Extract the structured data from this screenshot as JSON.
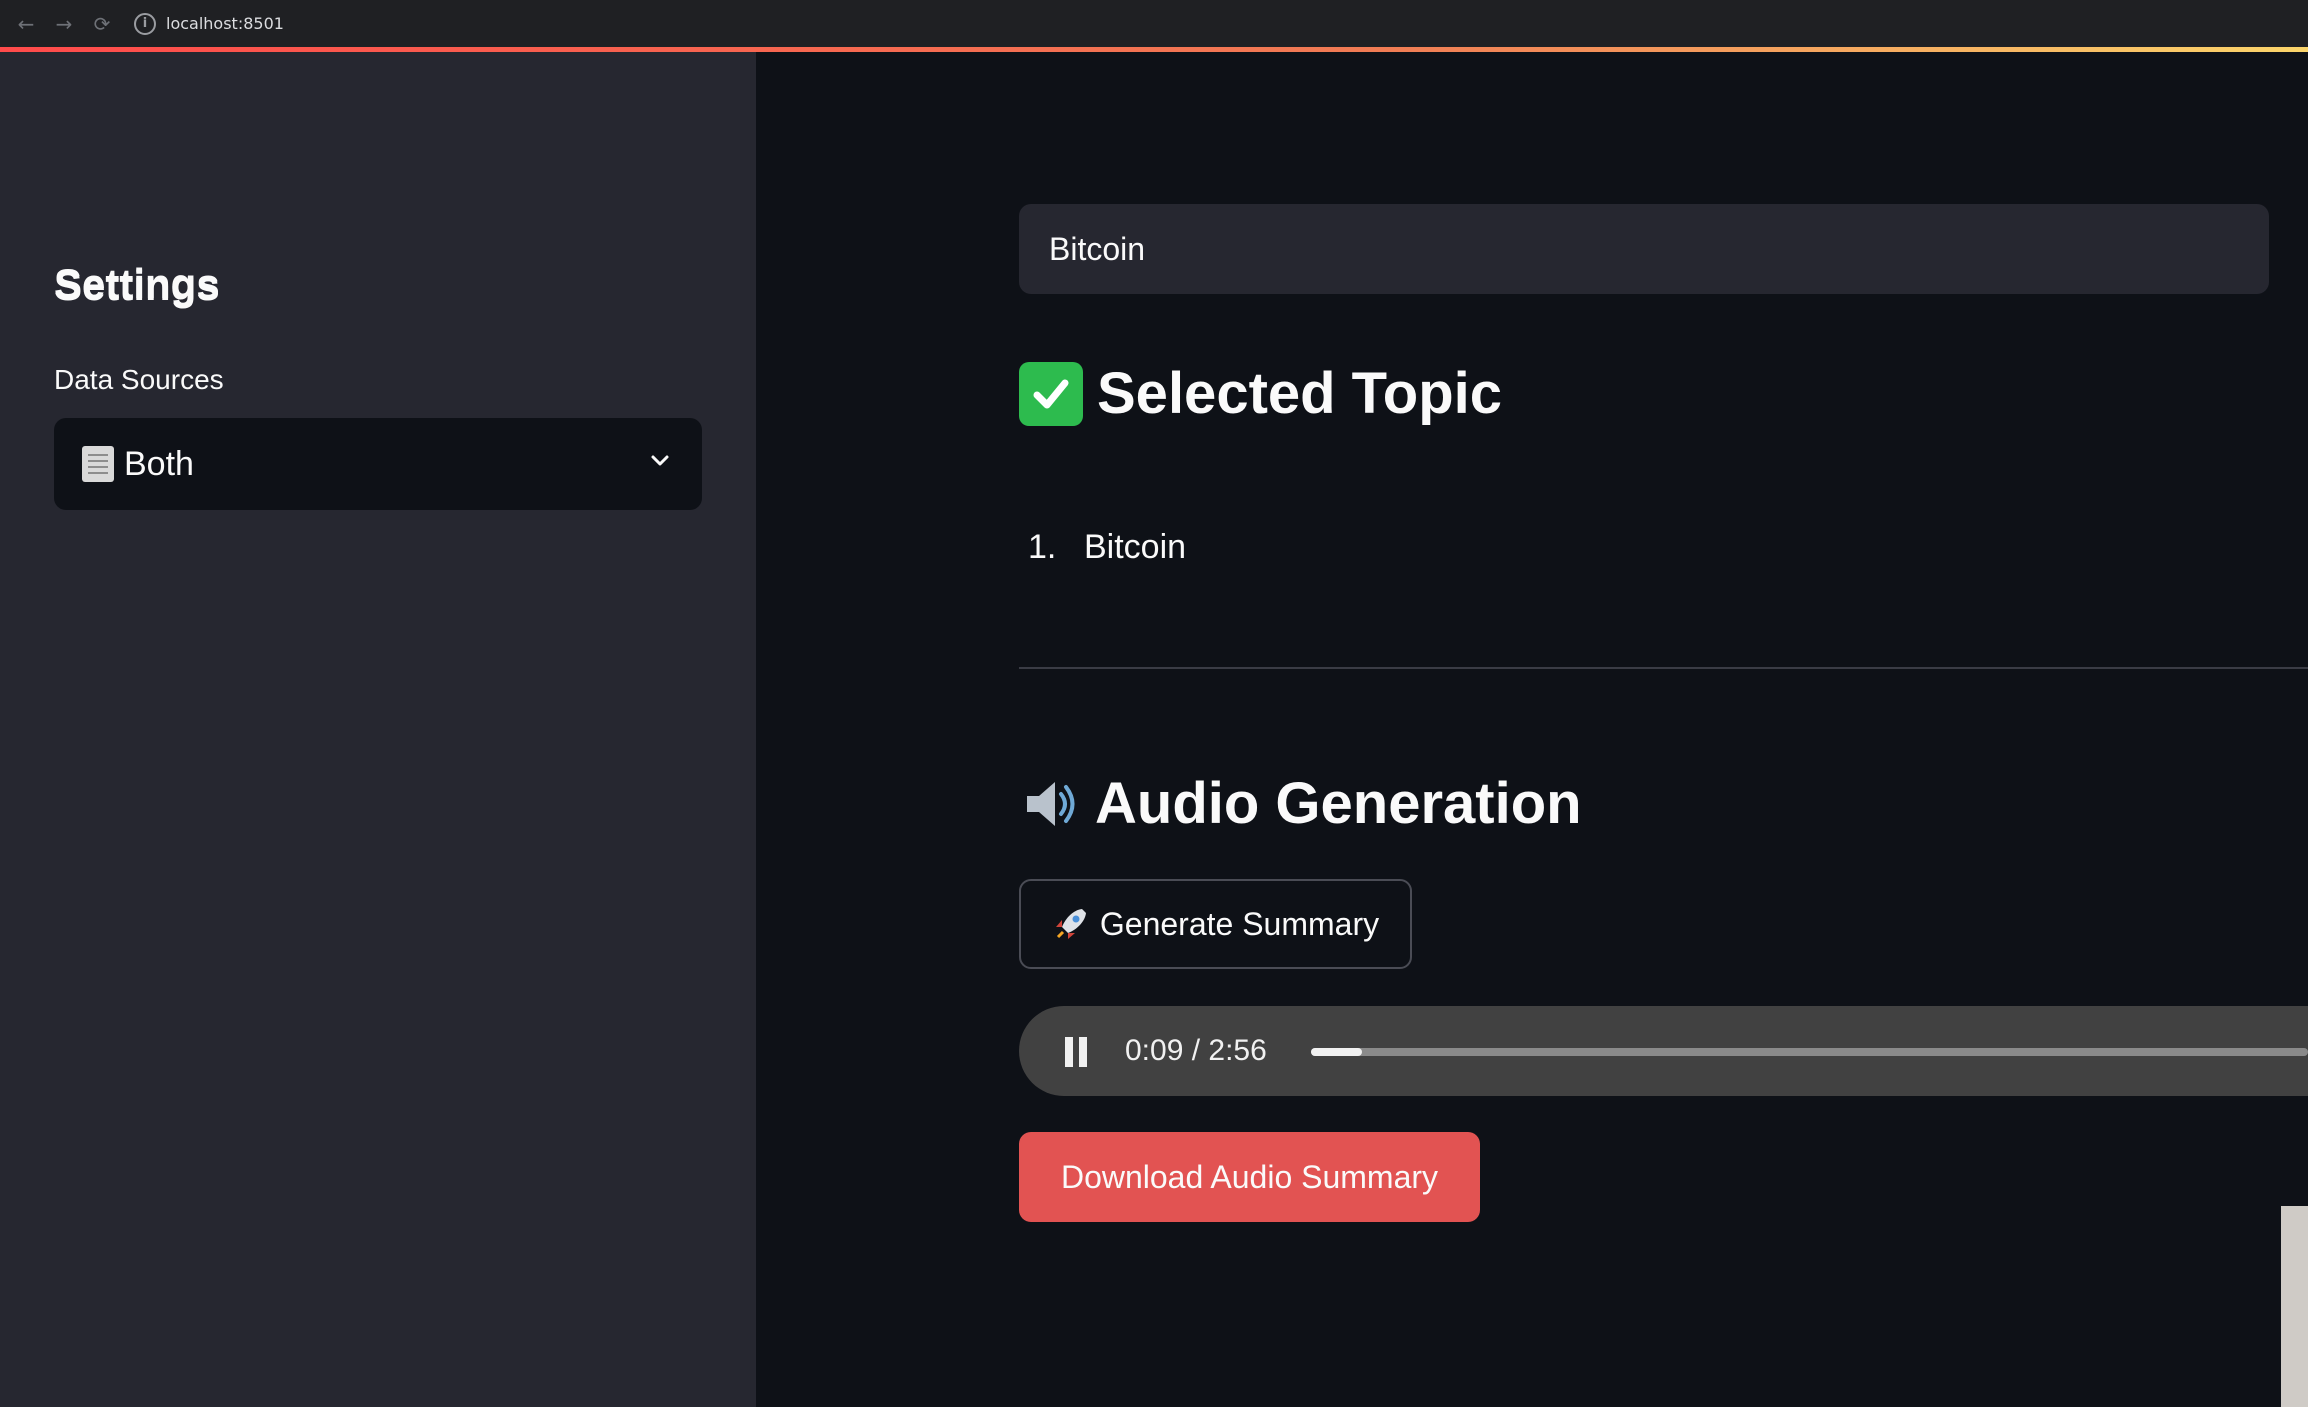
{
  "browser": {
    "url": "localhost:8501",
    "nav_icons": [
      "back-arrow-icon",
      "forward-arrow-icon",
      "reload-icon",
      "site-info-icon"
    ]
  },
  "sidebar": {
    "title": "Settings",
    "data_sources_label": "Data Sources",
    "data_sources_selected": "Both",
    "data_sources_icon": "newspaper-icon"
  },
  "main": {
    "topic_input_value": "Bitcoin",
    "selected_topic_heading": "Selected Topic",
    "selected_topic_icon": "check-mark-icon",
    "topics": [
      {
        "number": "1.",
        "label": "Bitcoin"
      }
    ],
    "audio_heading": "Audio Generation",
    "audio_icon": "speaker-icon",
    "generate_button_label": "Generate Summary",
    "generate_button_icon": "rocket-icon",
    "audio_player": {
      "time": "0:09 / 2:56",
      "progress_fraction": 0.051
    },
    "download_button_label": "Download Audio Summary"
  },
  "colors": {
    "accent": "#ff4b4b",
    "download_button": "#e25352",
    "sidebar_bg": "#262730",
    "main_bg": "#0e1117"
  }
}
